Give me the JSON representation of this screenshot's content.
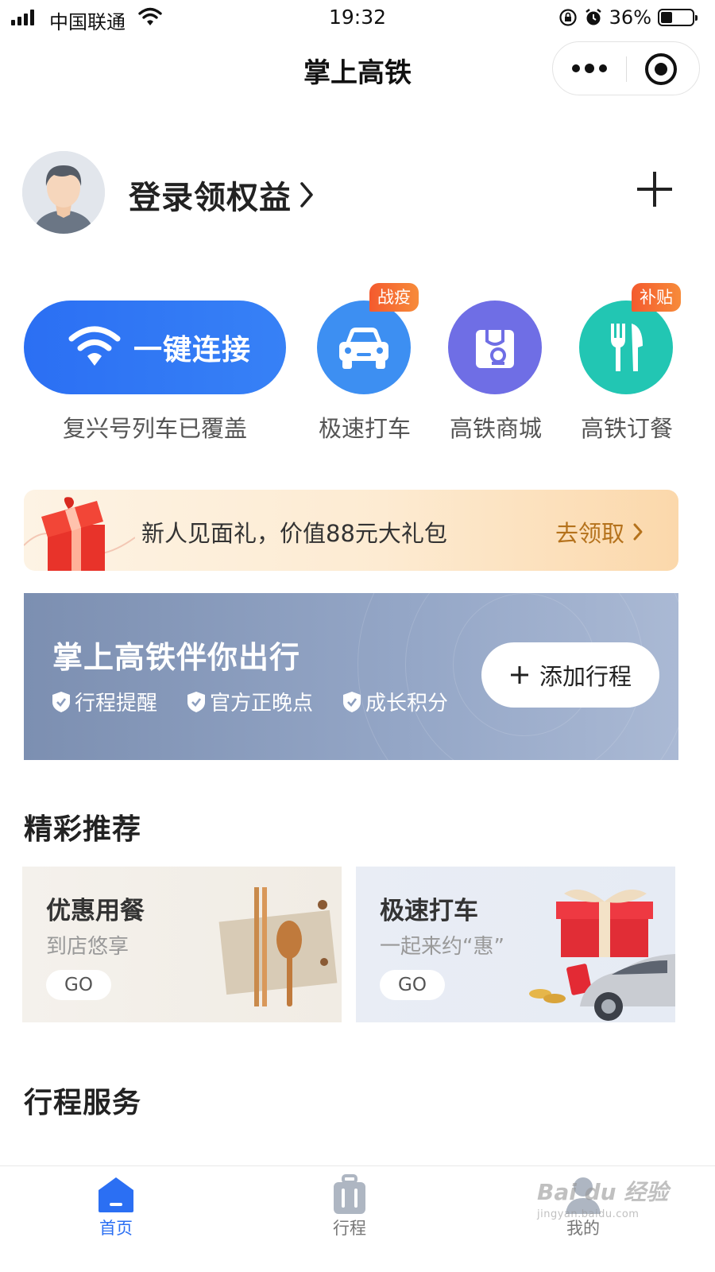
{
  "status_bar": {
    "carrier": "中国联通",
    "time": "19:32",
    "battery": "36%"
  },
  "nav": {
    "title": "掌上高铁"
  },
  "user": {
    "login_label": "登录领权益"
  },
  "quick_actions": {
    "wifi": {
      "label": "一键连接",
      "caption": "复兴号列车已覆盖"
    },
    "items": [
      {
        "label": "极速打车",
        "badge": "战疫",
        "icon": "car-icon",
        "color": "#3d8ff2"
      },
      {
        "label": "高铁商城",
        "badge": "",
        "icon": "shopping-bag-icon",
        "color": "#6f6ee5"
      },
      {
        "label": "高铁订餐",
        "badge": "补贴",
        "icon": "fork-knife-icon",
        "color": "#22c6b3"
      }
    ]
  },
  "promo": {
    "text": "新人见面礼，价值88元大礼包",
    "link": "去领取"
  },
  "trip": {
    "title": "掌上高铁伴你出行",
    "features": [
      "行程提醒",
      "官方正晚点",
      "成长积分"
    ],
    "add_label": "添加行程"
  },
  "recommend": {
    "title": "精彩推荐",
    "cards": [
      {
        "title": "优惠用餐",
        "subtitle": "到店悠享",
        "go": "GO"
      },
      {
        "title": "极速打车",
        "subtitle": "一起来约“惠”",
        "go": "GO"
      }
    ]
  },
  "services": {
    "title": "行程服务"
  },
  "tabbar": {
    "tabs": [
      {
        "label": "首页",
        "active": true
      },
      {
        "label": "行程",
        "active": false
      },
      {
        "label": "我的",
        "active": false
      }
    ]
  },
  "watermark": {
    "brand": "Bai du 经验",
    "url": "jingyan.baidu.com"
  },
  "colors": {
    "primary": "#2b6ff3",
    "tab_active": "#2b6ff3",
    "badge": "#f45a2e",
    "promo_link": "#b5721c"
  }
}
